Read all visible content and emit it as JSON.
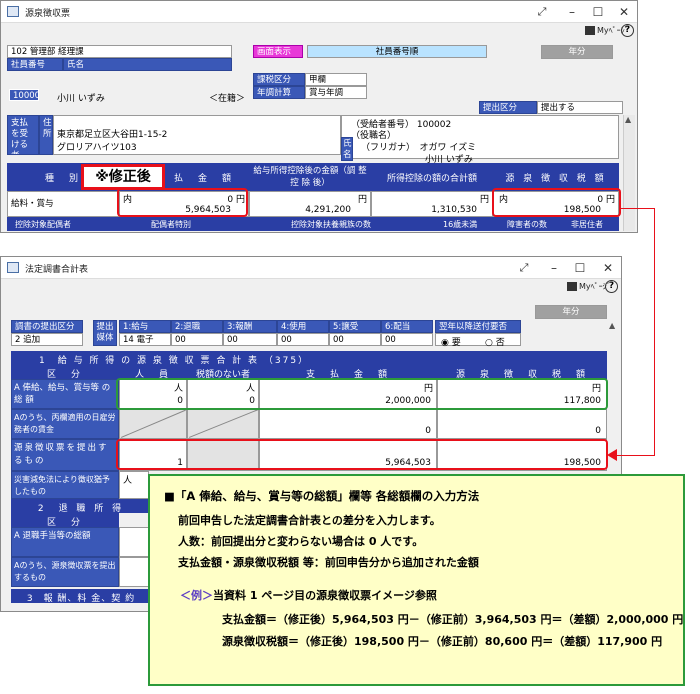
{
  "win1": {
    "title": "源泉徴収票",
    "dept": "102 管理部 経理課",
    "emp_no_label": "社員番号",
    "name_label": "氏名",
    "emp_no": "100002",
    "emp_name": "小川 いずみ",
    "status": "＜在籍＞",
    "screen_display": "画面表示",
    "emp_no_order": "社員番号順",
    "year_btn": "年分",
    "tax_category_label": "課税区分",
    "tax_category": "甲欄",
    "year_end_label": "年調計算",
    "year_end": "賞与年調",
    "submit_label": "提出区分",
    "submit_value": "提出する",
    "payer_label": "支払を受ける者",
    "address_label": "住所",
    "address": "東京都足立区大谷田1-15-2",
    "building": "グロリアハイツ103",
    "recipient_no": "（受給者番号） 100002",
    "position": "（役職名）",
    "name_side": "氏名",
    "furigana": "（フリガナ）　オガワ イズミ",
    "kanji_name": "小川 いずみ",
    "col_type": "種　別",
    "col_payment": "払　金　額",
    "col_deduction": "給与所得控除後の金額（調 整 控 除 後）",
    "col_total_deduction": "所得控除の額の合計額",
    "col_withholding": "源 泉 徴 収 税 額",
    "corrected_label": "※修正後",
    "row_type": "給料・賞与",
    "uchi": "内",
    "yen": "円",
    "pay_amount": "5,964,503",
    "pay_zero": "0",
    "deduct_amount": "4,291,200",
    "total_deduct": "1,310,530",
    "withholding": "198,500",
    "withholding_zero": "0",
    "bottom_labels": [
      "控除対象配偶者",
      "配偶者特別",
      "控除対象扶養親族の数",
      "16歳未満",
      "障害者の数",
      "非居住者"
    ]
  },
  "win2": {
    "title": "法定調書合計表",
    "year_btn": "年分",
    "submit_kind_label": "調書の提出区分",
    "submit_kind": "2 追加",
    "doc_label": "提出媒体",
    "doc_tabs": [
      "1:給与",
      "2:退職",
      "3:報酬",
      "4:使用",
      "5:譲受",
      "6:配当"
    ],
    "medium": "14 電子",
    "medium_values": [
      "00",
      "00",
      "00",
      "00",
      "00"
    ],
    "next_year_label": "翌年以降送付要否",
    "radio_yes": "要",
    "radio_no": "否",
    "sec1_title": "1　給 与 所 得 の 源 泉 徴 収 票 合 計 表 （375）",
    "col_kubun": "区　分",
    "col_people": "人　員",
    "col_no_tax": "税額のない者",
    "col_payment": "支　払　金　額",
    "col_withholding": "源　泉　徴　収　税　額",
    "row_a_label": "A 俸給、給与、賞与等 の 総 額",
    "row_b_label": "Aのうち、丙欄適用の日雇労務者の賃金",
    "row_c_label": "源泉徴収票を提出するもの",
    "row_d_label": "災害減免法により徴収猶予したもの",
    "nin": "人",
    "yen": "円",
    "a_people": "0",
    "a_no_tax": "0",
    "a_payment": "2,000,000",
    "a_withholding": "117,800",
    "b_payment": "0",
    "b_withholding": "0",
    "c_people": "1",
    "c_payment": "5,964,503",
    "c_withholding": "198,500",
    "sec2_title": "2　退 職 所 得",
    "sec2_kubun": "区　分",
    "sec2_row_a": "A 退職手当等の総額",
    "sec2_row_b": "Aのうち、源泉徴収票を提出するもの",
    "sec3_title": "3　報 酬、料 金、契 約"
  },
  "note": {
    "heading": "■「A 俸給、給与、賞与等の総額」欄等 各総額欄の入力方法",
    "line1": "前回申告した法定調書合計表との差分を入力します。",
    "line2": "人数：前回提出分と変わらない場合は 0 人です。",
    "line3": "支払金額・源泉徴収税額 等：前回申告分から追加された金額",
    "example_label": "＜例＞",
    "example_text": "当資料 1 ページ目の源泉徴収票イメージ参照",
    "calc1": "支払金額＝（修正後）5,964,503 円－（修正前）3,964,503 円＝（差額）2,000,000 円",
    "calc2": "源泉徴収税額＝（修正後）198,500 円－（修正前）80,600 円＝（差額）117,900 円"
  },
  "colors": {
    "header_blue": "#2a3ea4",
    "red_highlight": "#e8101a",
    "green_highlight": "#2c9a3a",
    "note_bg": "#ffffc7"
  }
}
